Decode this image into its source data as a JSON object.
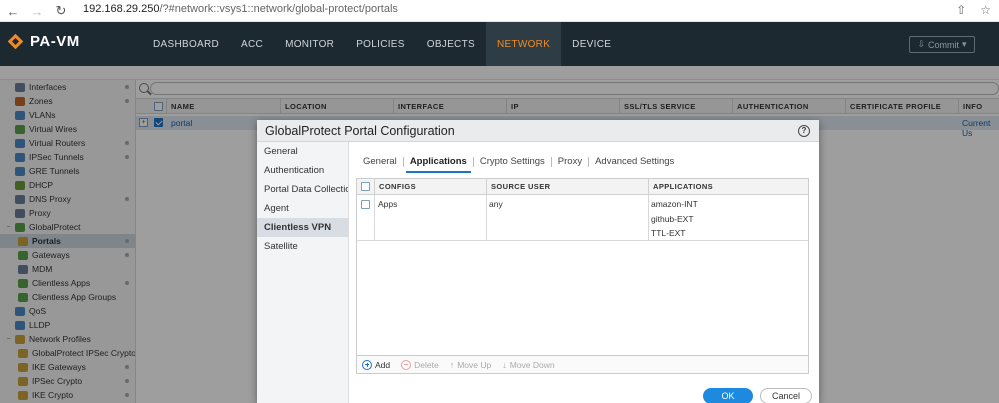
{
  "browser": {
    "url_host": "192.168.29.250",
    "url_path": "/?#network::vsys1::network/global-protect/portals"
  },
  "app": {
    "logo": "PA-VM",
    "tabs": [
      "DASHBOARD",
      "ACC",
      "MONITOR",
      "POLICIES",
      "OBJECTS",
      "NETWORK",
      "DEVICE"
    ],
    "active_tab": "NETWORK",
    "commit_label": "Commit"
  },
  "sidebar": {
    "items": [
      {
        "label": "Interfaces",
        "icon": "interfaces-icon",
        "color": "#6b7f99",
        "indent": 0,
        "dot": true
      },
      {
        "label": "Zones",
        "icon": "zones-icon",
        "color": "#c0662b",
        "indent": 0,
        "dot": true
      },
      {
        "label": "VLANs",
        "icon": "vlans-icon",
        "color": "#4c8bc5",
        "indent": 0,
        "dot": false
      },
      {
        "label": "Virtual Wires",
        "icon": "virtual-wires-icon",
        "color": "#5aa24a",
        "indent": 0,
        "dot": false
      },
      {
        "label": "Virtual Routers",
        "icon": "virtual-routers-icon",
        "color": "#4c8bc5",
        "indent": 0,
        "dot": true
      },
      {
        "label": "IPSec Tunnels",
        "icon": "ipsec-tunnels-icon",
        "color": "#4c8bc5",
        "indent": 0,
        "dot": true
      },
      {
        "label": "GRE Tunnels",
        "icon": "gre-tunnels-icon",
        "color": "#4c8bc5",
        "indent": 0,
        "dot": false
      },
      {
        "label": "DHCP",
        "icon": "dhcp-icon",
        "color": "#6a9b3a",
        "indent": 0,
        "dot": false
      },
      {
        "label": "DNS Proxy",
        "icon": "dns-proxy-icon",
        "color": "#6b7f99",
        "indent": 0,
        "dot": true
      },
      {
        "label": "Proxy",
        "icon": "proxy-icon",
        "color": "#6b7f99",
        "indent": 0,
        "dot": false
      },
      {
        "label": "GlobalProtect",
        "icon": "globalprotect-icon",
        "color": "#5aa24a",
        "indent": 0,
        "dot": false,
        "expanded": true
      },
      {
        "label": "Portals",
        "icon": "portals-icon",
        "color": "#c8a23a",
        "indent": 1,
        "dot": true,
        "active": true
      },
      {
        "label": "Gateways",
        "icon": "gateways-icon",
        "color": "#5aa24a",
        "indent": 1,
        "dot": true
      },
      {
        "label": "MDM",
        "icon": "mdm-icon",
        "color": "#6b7f99",
        "indent": 1,
        "dot": false
      },
      {
        "label": "Clientless Apps",
        "icon": "clientless-apps-icon",
        "color": "#5aa24a",
        "indent": 1,
        "dot": true
      },
      {
        "label": "Clientless App Groups",
        "icon": "clientless-app-groups-icon",
        "color": "#5aa24a",
        "indent": 1,
        "dot": false
      },
      {
        "label": "QoS",
        "icon": "qos-icon",
        "color": "#4c8bc5",
        "indent": 0,
        "dot": false
      },
      {
        "label": "LLDP",
        "icon": "lldp-icon",
        "color": "#4c8bc5",
        "indent": 0,
        "dot": false
      },
      {
        "label": "Network Profiles",
        "icon": "network-profiles-icon",
        "color": "#c8a23a",
        "indent": 0,
        "dot": false,
        "expanded": true
      },
      {
        "label": "GlobalProtect IPSec Crypto",
        "icon": "gp-ipsec-crypto-icon",
        "color": "#c8a23a",
        "indent": 1,
        "dot": false
      },
      {
        "label": "IKE Gateways",
        "icon": "ike-gateways-icon",
        "color": "#c8a23a",
        "indent": 1,
        "dot": true
      },
      {
        "label": "IPSec Crypto",
        "icon": "ipsec-crypto-icon",
        "color": "#c8a23a",
        "indent": 1,
        "dot": true
      },
      {
        "label": "IKE Crypto",
        "icon": "ike-crypto-icon",
        "color": "#c8a23a",
        "indent": 1,
        "dot": true
      }
    ]
  },
  "grid": {
    "columns": [
      "NAME",
      "LOCATION",
      "INTERFACE",
      "IP",
      "SSL/TLS SERVICE PROFILE",
      "AUTHENTICATION PROFILE",
      "CERTIFICATE PROFILE",
      "INFO"
    ],
    "row": {
      "name": "portal",
      "info": "Current Us"
    }
  },
  "modal": {
    "title": "GlobalProtect Portal Configuration",
    "help": "?",
    "left_nav": [
      "General",
      "Authentication",
      "Portal Data Collection",
      "Agent",
      "Clientless VPN",
      "Satellite"
    ],
    "left_active": "Clientless VPN",
    "tabs": [
      "General",
      "Applications",
      "Crypto Settings",
      "Proxy",
      "Advanced Settings"
    ],
    "active_tab": "Applications",
    "table": {
      "columns": [
        "CONFIGS",
        "SOURCE USER",
        "APPLICATIONS"
      ],
      "rows": [
        {
          "config": "Apps",
          "source_user": "any",
          "applications": [
            "amazon-INT",
            "github-EXT",
            "TTL-EXT"
          ]
        }
      ]
    },
    "footer": {
      "add": "Add",
      "delete": "Delete",
      "move_up": "Move Up",
      "move_down": "Move Down"
    },
    "ok": "OK",
    "cancel": "Cancel"
  }
}
